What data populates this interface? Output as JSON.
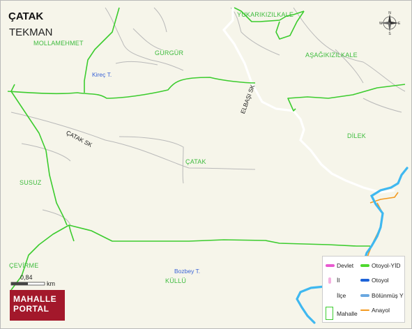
{
  "header": {
    "title": "ÇATAK",
    "subtitle": "TEKMAN"
  },
  "places": {
    "yukarikizilkale": "YUKARIKIZILKALE",
    "mollamehmet": "MOLLAMEHMET",
    "gurgur": "GÜRGÜR",
    "asagikizilkale": "AŞAĞIKIZILKALE",
    "dilek": "DİLEK",
    "catak": "ÇATAK",
    "susuz": "SUSUZ",
    "cevirme": "ÇEVİRME",
    "kullu": "KÜLLÜ"
  },
  "waters": {
    "kirec": "Kireç T.",
    "bozbey": "Bozbey T."
  },
  "roads": {
    "elbasi": "ELBAŞI SK",
    "catak_sk": "ÇATAK SK"
  },
  "compass": {
    "n": "N",
    "s": "S",
    "e": "E",
    "w": "W"
  },
  "scale": {
    "value": "0,84",
    "unit": "km"
  },
  "brand": {
    "line1": "MAHALLE",
    "line2": "PORTAL"
  },
  "legend": {
    "devlet": "Devlet",
    "il": "İl",
    "ilce": "İlçe",
    "mahalle": "Mahalle",
    "otoyol_yid": "Otoyol-YİD",
    "otoyol": "Otoyol",
    "bolunmus": "Bölünmüş Y",
    "anayol": "Anayol"
  },
  "colors": {
    "background": "#f6f5ea",
    "mahalle_border": "#3ccc2e",
    "river": "#3fb8f0",
    "anayol": "#f39a21",
    "devlet": "#e85ad0",
    "il": "#f3b0df",
    "otoyol_yid": "#4ed82e",
    "otoyol": "#1e63d8",
    "bolunmus": "#6aa8e0",
    "brand": "#a3182b"
  }
}
